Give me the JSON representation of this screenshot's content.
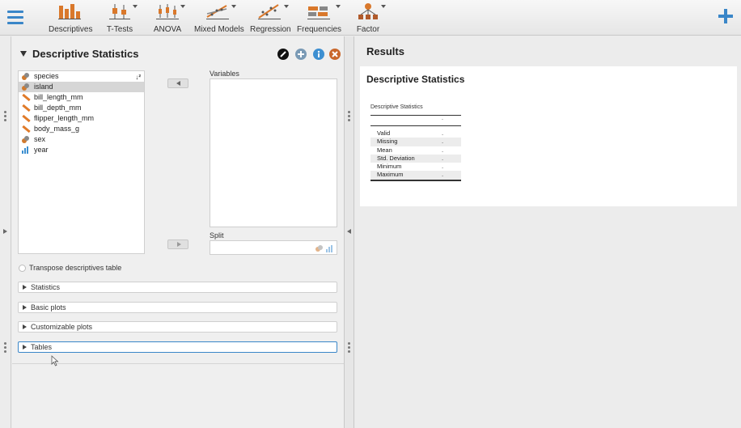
{
  "toolbar": {
    "items": [
      {
        "label": "Descriptives",
        "icon": "descriptives-bar-chart-icon",
        "has_menu": false
      },
      {
        "label": "T-Tests",
        "icon": "t-tests-icon",
        "has_menu": true
      },
      {
        "label": "ANOVA",
        "icon": "anova-icon",
        "has_menu": true
      },
      {
        "label": "Mixed Models",
        "icon": "mixed-models-icon",
        "has_menu": true
      },
      {
        "label": "Regression",
        "icon": "regression-icon",
        "has_menu": true
      },
      {
        "label": "Frequencies",
        "icon": "frequencies-icon",
        "has_menu": true
      },
      {
        "label": "Factor",
        "icon": "factor-icon",
        "has_menu": true
      }
    ],
    "accent": "#3a86c8"
  },
  "analysis": {
    "title": "Descriptive Statistics",
    "header_buttons": [
      {
        "name": "edit-title",
        "icon": "pencil-icon",
        "color": "#111111"
      },
      {
        "name": "duplicate",
        "icon": "plus-circle-icon",
        "color": "#7a9ab5"
      },
      {
        "name": "info",
        "icon": "info-icon",
        "color": "#3d8fd1"
      },
      {
        "name": "close",
        "icon": "close-icon",
        "color": "#c9672b"
      }
    ],
    "variables": [
      {
        "name": "species",
        "type": "nominal"
      },
      {
        "name": "island",
        "type": "nominal",
        "selected": true
      },
      {
        "name": "bill_length_mm",
        "type": "scale"
      },
      {
        "name": "bill_depth_mm",
        "type": "scale"
      },
      {
        "name": "flipper_length_mm",
        "type": "scale"
      },
      {
        "name": "body_mass_g",
        "type": "scale"
      },
      {
        "name": "sex",
        "type": "nominal"
      },
      {
        "name": "year",
        "type": "ordinal"
      }
    ],
    "variables_box_label": "Variables",
    "split_box_label": "Split",
    "transpose_label": "Transpose descriptives table",
    "sections": [
      "Statistics",
      "Basic plots",
      "Customizable plots",
      "Tables"
    ],
    "active_section": "Tables"
  },
  "results": {
    "title": "Results",
    "heading": "Descriptive Statistics",
    "table": {
      "caption": "Descriptive Statistics",
      "column_header": ".",
      "rows": [
        {
          "label": "Valid",
          "value": "."
        },
        {
          "label": "Missing",
          "value": "."
        },
        {
          "label": "Mean",
          "value": "."
        },
        {
          "label": "Std. Deviation",
          "value": "."
        },
        {
          "label": "Minimum",
          "value": "."
        },
        {
          "label": "Maximum",
          "value": "."
        }
      ]
    }
  }
}
